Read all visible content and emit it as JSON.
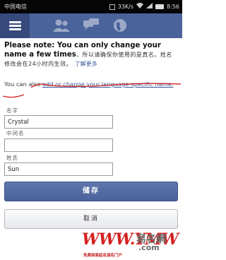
{
  "status_bar": {
    "carrier": "中国电信",
    "speed": "33K/s",
    "time": "8:56"
  },
  "navbar": {
    "menu_icon": "hamburger-icon",
    "icons": [
      "friends-icon",
      "messages-icon",
      "globe-icon"
    ]
  },
  "notice": {
    "title": "Please note: You can only change your name a few times",
    "detail": "，所以请确保你使用的是真名。姓名修改会在24小时内生效。",
    "more_link": "了解更多"
  },
  "language_note": {
    "prefix": "You can also ",
    "link": "add or change your language-specific name."
  },
  "form": {
    "first_name_label": "名字",
    "first_name_value": "Crystal",
    "middle_name_label": "中间名",
    "middle_name_value": "",
    "last_name_label": "姓氏",
    "last_name_value": "Sun"
  },
  "buttons": {
    "save": "储存",
    "cancel": "取消"
  },
  "watermark": {
    "logo": "WWW.YMW",
    "name": "易名網",
    "domain": ".com",
    "slogan": "免费网易起名测名门户"
  },
  "colors": {
    "navbar": "#4a639b",
    "link": "#3b5998",
    "annotation": "#d42020"
  }
}
